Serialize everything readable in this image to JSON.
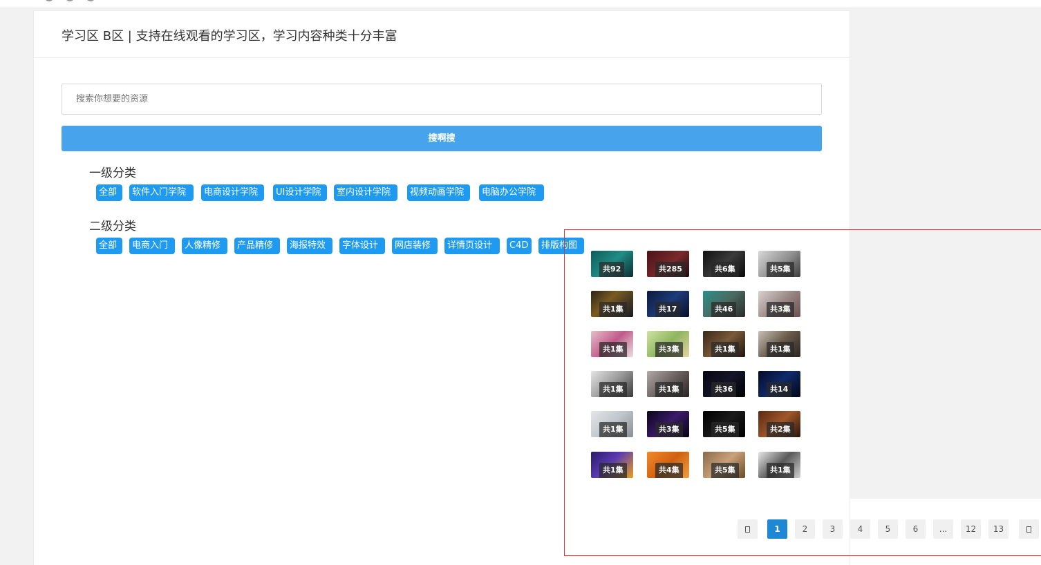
{
  "header": {
    "title": "学习区 B区 | 支持在线观看的学习区，学习内容种类十分丰富"
  },
  "search": {
    "placeholder": "搜索你想要的资源",
    "button_label": "搜啊搜"
  },
  "categories": {
    "level1": {
      "title": "一级分类",
      "tags": [
        "全部",
        "软件入门学院",
        "电商设计学院",
        "UI设计学院",
        "室内设计学院",
        "视频动画学院",
        "电脑办公学院"
      ]
    },
    "level2": {
      "title": "二级分类",
      "tags": [
        "全部",
        "电商入门",
        "人像精修",
        "产品精修",
        "海报特效",
        "字体设计",
        "网店装修",
        "详情页设计",
        "C4D",
        "排版构图"
      ]
    }
  },
  "videos": [
    {
      "count": "共92",
      "theme": "teal"
    },
    {
      "count": "共285",
      "theme": "maroon"
    },
    {
      "count": "共6集",
      "theme": "dark"
    },
    {
      "count": "共5集",
      "theme": "grey"
    },
    {
      "count": "共1集",
      "theme": "darkblue"
    },
    {
      "count": "共17",
      "theme": "navy"
    },
    {
      "count": "共46",
      "theme": "teal2"
    },
    {
      "count": "共3集",
      "theme": "grey2"
    },
    {
      "count": "共1集",
      "theme": "pink"
    },
    {
      "count": "共3集",
      "theme": "green"
    },
    {
      "count": "共1集",
      "theme": "brown"
    },
    {
      "count": "共1集",
      "theme": "brown2"
    },
    {
      "count": "共1集",
      "theme": "grey3"
    },
    {
      "count": "共1集",
      "theme": "grey4"
    },
    {
      "count": "共36",
      "theme": "black"
    },
    {
      "count": "共14",
      "theme": "navy2"
    },
    {
      "count": "共1集",
      "theme": "light"
    },
    {
      "count": "共3集",
      "theme": "purple"
    },
    {
      "count": "共5集",
      "theme": "black2"
    },
    {
      "count": "共2集",
      "theme": "orange"
    },
    {
      "count": "共1集",
      "theme": "violet"
    },
    {
      "count": "共4集",
      "theme": "orange2"
    },
    {
      "count": "共5集",
      "theme": "tan"
    },
    {
      "count": "共1集",
      "theme": "grey5"
    }
  ],
  "pagination": {
    "prev_icon": "prev-arrow-icon",
    "next_icon": "next-arrow-icon",
    "pages": [
      "1",
      "2",
      "3",
      "4",
      "5",
      "6",
      "...",
      "12",
      "13"
    ],
    "current": "1"
  },
  "colors": {
    "accent": "#1e9bf0",
    "search_button": "#46a3ec",
    "page_active": "#1e88d4",
    "highlight_frame": "#d6373a"
  }
}
